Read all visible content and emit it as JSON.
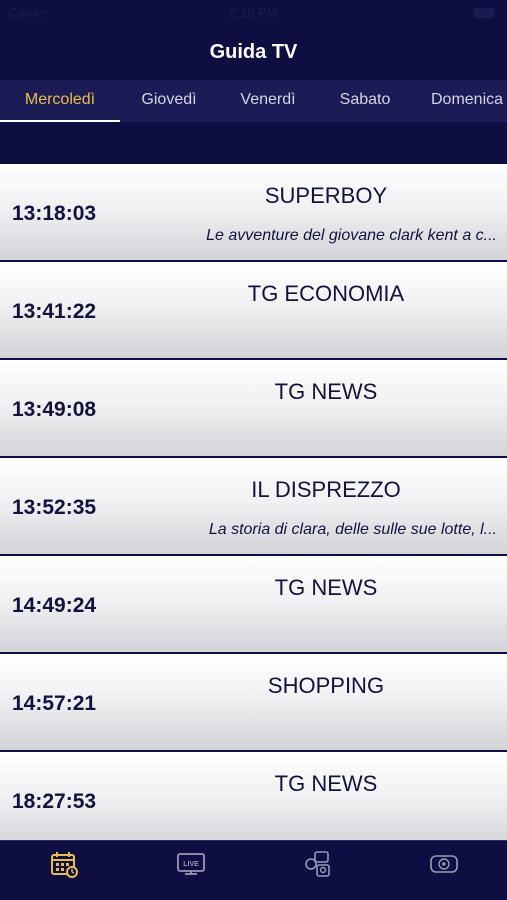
{
  "status": {
    "carrier": "Carrier",
    "time": "2:18 PM"
  },
  "header": {
    "title": "Guida TV"
  },
  "tabs": [
    {
      "label": "Mercoledì",
      "active": true
    },
    {
      "label": "Giovedì",
      "active": false
    },
    {
      "label": "Venerdì",
      "active": false
    },
    {
      "label": "Sabato",
      "active": false
    },
    {
      "label": "Domenica",
      "active": false
    }
  ],
  "programs": [
    {
      "time": "13:18:03",
      "title": "SUPERBOY",
      "description": "Le avventure del giovane clark kent a c..."
    },
    {
      "time": "13:41:22",
      "title": "TG ECONOMIA",
      "description": ""
    },
    {
      "time": "13:49:08",
      "title": "TG NEWS",
      "description": ""
    },
    {
      "time": "13:52:35",
      "title": "IL DISPREZZO",
      "description": "La  storia di clara, delle sulle sue lotte, l..."
    },
    {
      "time": "14:49:24",
      "title": "TG NEWS",
      "description": ""
    },
    {
      "time": "14:57:21",
      "title": "SHOPPING",
      "description": ""
    },
    {
      "time": "18:27:53",
      "title": "TG NEWS",
      "description": ""
    }
  ],
  "bottom_nav": [
    {
      "icon": "calendar-icon",
      "active": true
    },
    {
      "icon": "live-tv-icon",
      "active": false
    },
    {
      "icon": "social-icon",
      "active": false
    },
    {
      "icon": "video-icon",
      "active": false
    }
  ],
  "colors": {
    "background": "#0e0e42",
    "accent": "#e9c046",
    "tab_bar": "#1b1b55",
    "text": "#12123f"
  }
}
